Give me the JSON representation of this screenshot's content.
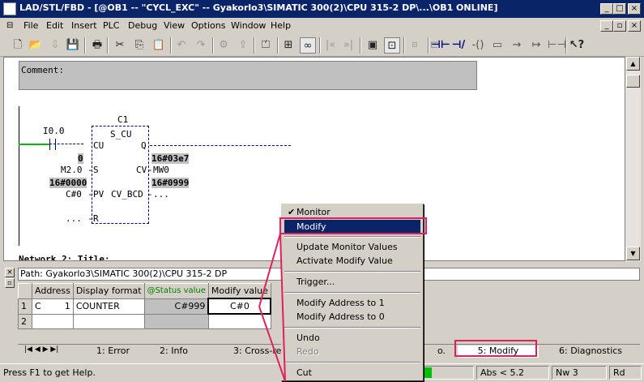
{
  "window": {
    "title": "LAD/STL/FBD - [@OB1 -- \"CYCL_EXC\" -- Gyakorlo3\\SIMATIC 300(2)\\CPU 315-2 DP\\...\\OB1  ONLINE]"
  },
  "menu": [
    "File",
    "Edit",
    "Insert",
    "PLC",
    "Debug",
    "View",
    "Options",
    "Window",
    "Help"
  ],
  "editor": {
    "comment": "Comment:",
    "block_name": "C1",
    "block_type": "S_CU",
    "input_contact": "I0.0",
    "pin_cu": "CU",
    "pin_q": "Q",
    "pin_s": "S",
    "pin_pv": "PV",
    "pin_cv": "CV",
    "pin_cv_bcd": "CV_BCD",
    "pin_r": "R",
    "val_s": "0",
    "op_s": "M2.0",
    "val_cv": "16#03e7",
    "op_cv": "MW0",
    "val_pv": "16#0000",
    "op_pv": "C#0",
    "val_cvbcd": "16#0999",
    "op_cvbcd": "...",
    "op_r": "...",
    "network_title": "Network 2: Title:"
  },
  "panel": {
    "path": "Path: Gyakorlo3\\SIMATIC 300(2)\\CPU 315-2 DP",
    "columns": [
      "Address",
      "Display format",
      "@Status value",
      "Modify value"
    ],
    "rows": [
      {
        "num": "1",
        "address_type": "C",
        "address_num": "1",
        "format": "COUNTER",
        "status": "C#999",
        "modify": "C#0"
      },
      {
        "num": "2",
        "address_type": "",
        "address_num": "",
        "format": "",
        "status": "",
        "modify": ""
      }
    ],
    "tabs": [
      "1: Error",
      "2: Info",
      "3: Cross-refe",
      "o.",
      "5: Modify",
      "6: Diagnostics"
    ]
  },
  "status": {
    "help": "Press F1 to get Help.",
    "mode": "Abs < 5.2",
    "network": "Nw 3",
    "rd": "Rd"
  },
  "context_menu": {
    "items": [
      {
        "label": "Monitor",
        "checked": true
      },
      {
        "label": "Modify",
        "highlighted": true
      },
      {
        "separator": true
      },
      {
        "label": "Update Monitor Values"
      },
      {
        "label": "Activate Modify Value"
      },
      {
        "separator": true
      },
      {
        "label": "Trigger..."
      },
      {
        "separator": true
      },
      {
        "label": "Modify Address to 1"
      },
      {
        "label": "Modify Address to 0"
      },
      {
        "separator": true
      },
      {
        "label": "Undo"
      },
      {
        "label": "Redo",
        "disabled": true
      },
      {
        "separator": true
      },
      {
        "label": "Cut"
      }
    ]
  },
  "colors": {
    "title_bar": "#0a246a",
    "highlight": "#0a246a",
    "annotation": "#e0205a",
    "rung_active": "#00c000",
    "status_green": "#00c000"
  }
}
